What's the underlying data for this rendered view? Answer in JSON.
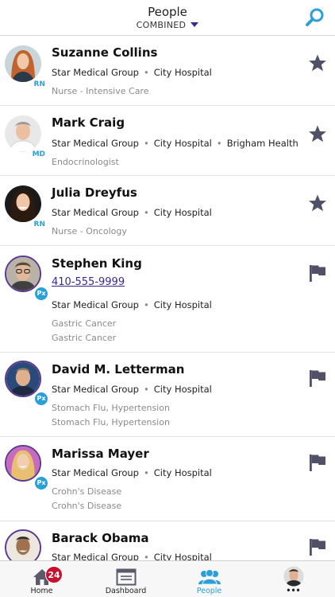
{
  "header": {
    "title": "People",
    "filter": "COMBINED",
    "search_icon": "search-icon"
  },
  "people": [
    {
      "name": "Suzanne Collins",
      "role": "RN",
      "orgs": [
        "Star Medical Group",
        "City Hospital"
      ],
      "details": [
        "Nurse - Intensive Care"
      ],
      "action": "star-icon"
    },
    {
      "name": "Mark Craig",
      "role": "MD",
      "orgs": [
        "Star Medical Group",
        "City Hospital",
        "Brigham Health"
      ],
      "details": [
        "Endocrinologist"
      ],
      "action": "star-icon"
    },
    {
      "name": "Julia Dreyfus",
      "role": "RN",
      "orgs": [
        "Star Medical Group",
        "City Hospital"
      ],
      "details": [
        "Nurse - Oncology"
      ],
      "action": "star-icon"
    },
    {
      "name": "Stephen King",
      "role": "Px",
      "phone": "410-555-9999",
      "orgs": [
        "Star Medical Group",
        "City Hospital"
      ],
      "details": [
        "Gastric Cancer",
        "Gastric Cancer"
      ],
      "action": "flag-icon"
    },
    {
      "name": "David M. Letterman",
      "role": "Px",
      "orgs": [
        "Star Medical Group",
        "City Hospital"
      ],
      "details": [
        "Stomach Flu, Hypertension",
        "Stomach Flu, Hypertension"
      ],
      "action": "flag-icon"
    },
    {
      "name": "Marissa Mayer",
      "role": "Px",
      "orgs": [
        "Star Medical Group",
        "City Hospital"
      ],
      "details": [
        "Crohn's Disease",
        "Crohn's Disease"
      ],
      "action": "flag-icon"
    },
    {
      "name": "Barack Obama",
      "role": "Px",
      "orgs": [
        "Star Medical Group",
        "City Hospital"
      ],
      "details": [],
      "action": "flag-icon"
    }
  ],
  "tabbar": {
    "items": [
      {
        "label": "Home",
        "icon": "home-icon",
        "badge": "24"
      },
      {
        "label": "Dashboard",
        "icon": "dashboard-icon"
      },
      {
        "label": "People",
        "icon": "people-icon",
        "active": true
      },
      {
        "label": "•••",
        "icon": "profile-avatar"
      }
    ]
  },
  "colors": {
    "accent": "#2b9fd8",
    "link": "#3a2a8a",
    "badge_red": "#c8102e",
    "icon_gray": "#505068"
  }
}
